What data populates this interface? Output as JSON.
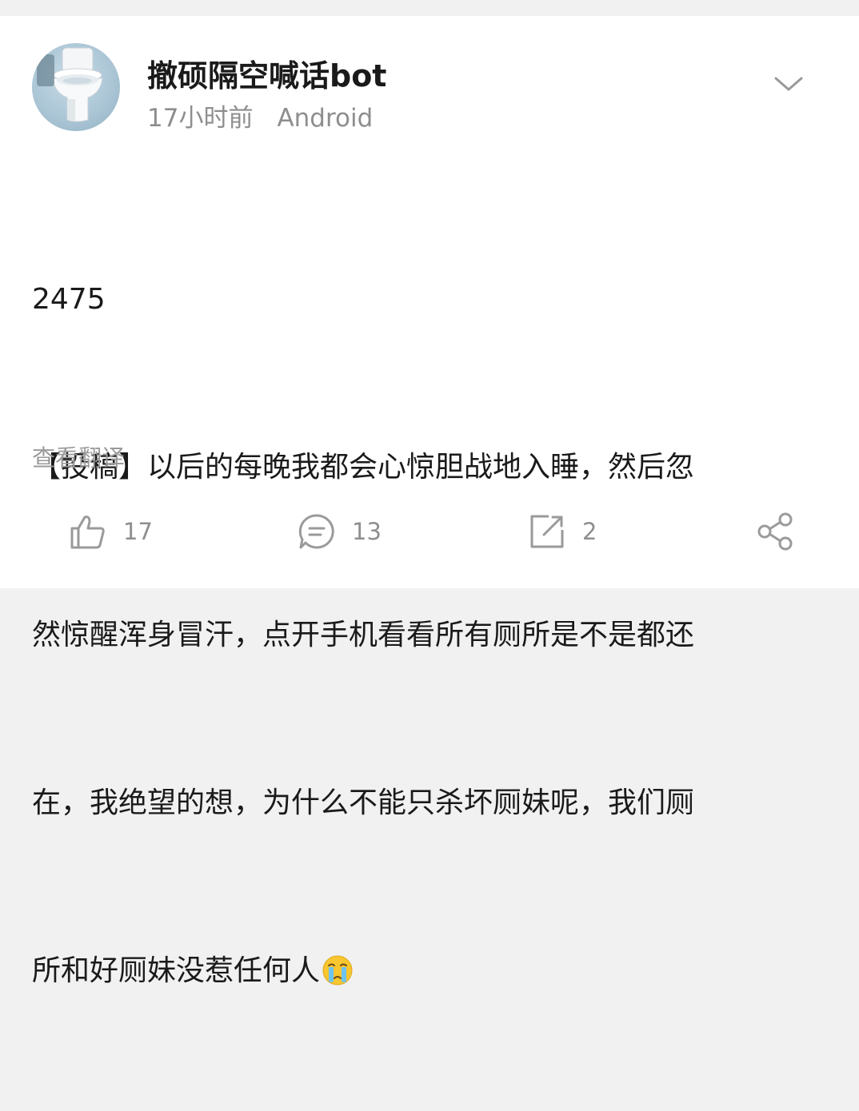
{
  "post": {
    "author": "撤硕隔空喊话bot",
    "time": "17小时前",
    "device": "Android",
    "body_lines": [
      "2475",
      "【投稿】以后的每晚我都会心惊胆战地入睡，然后忽",
      "然惊醒浑身冒汗，点开手机看看所有厕所是不是都还",
      "在，我绝望的想，为什么不能只杀坏厕妹呢，我们厕",
      "所和好厕妹没惹任何人"
    ],
    "emoji": "crying-face",
    "translate_label": "查看翻译"
  },
  "actions": {
    "like_count": "17",
    "comment_count": "13",
    "repost_count": "2"
  },
  "icons": {
    "avatar": "toilet-avatar",
    "menu": "chevron-down-icon",
    "like": "thumbs-up-icon",
    "comment": "comment-icon",
    "repost": "repost-icon",
    "share": "share-icon"
  },
  "colors": {
    "text_primary": "#1a1a1a",
    "text_secondary": "#8e8e8e",
    "background": "#f1f1f1",
    "card": "#ffffff"
  }
}
